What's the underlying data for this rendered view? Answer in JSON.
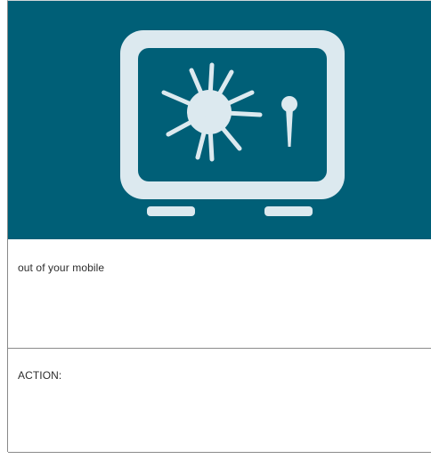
{
  "card": {
    "hero": {
      "icon": "safe-vault-icon",
      "background_color": "#005f77",
      "icon_color": "#dce9ef"
    },
    "subtitle": "out of your mobile",
    "action_label": "ACTION:"
  }
}
